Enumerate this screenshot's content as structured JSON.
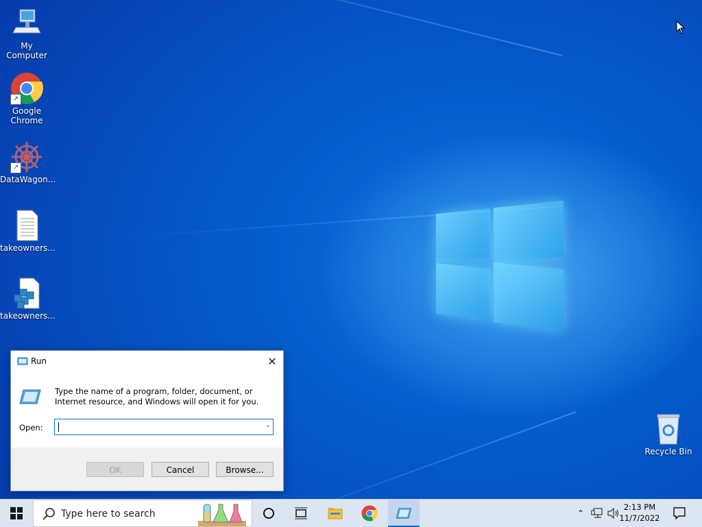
{
  "desktop": {
    "icons": [
      {
        "label": "My Computer",
        "icon": "computer-icon"
      },
      {
        "label": "Google Chrome",
        "icon": "chrome-icon"
      },
      {
        "label": "DataWagon...",
        "icon": "datawagon-icon"
      },
      {
        "label": "takeowners...",
        "icon": "text-file-icon"
      },
      {
        "label": "takeowners...",
        "icon": "registry-file-icon"
      },
      {
        "label": "Recycle Bin",
        "icon": "recycle-bin-icon"
      }
    ]
  },
  "run_dialog": {
    "title": "Run",
    "description": "Type the name of a program, folder, document, or Internet resource, and Windows will open it for you.",
    "open_label": "Open:",
    "open_value": "",
    "ok_label": "OK",
    "cancel_label": "Cancel",
    "browse_label": "Browse..."
  },
  "taskbar": {
    "search_placeholder": "Type here to search",
    "time": "2:13 PM",
    "date": "11/7/2022"
  },
  "colors": {
    "accent": "#0078d7",
    "taskbar": "#dce6f2"
  }
}
